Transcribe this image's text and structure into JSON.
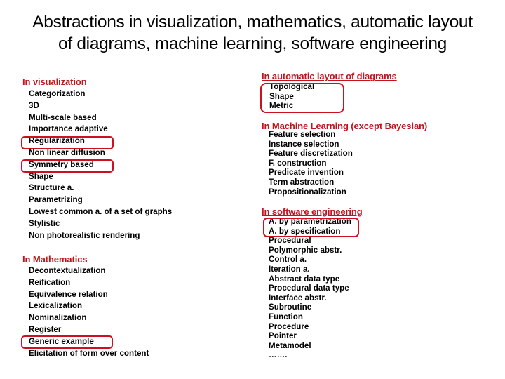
{
  "title": {
    "line1": "Abstractions in visualization, mathematics, automatic layout",
    "line2": "of diagrams, machine learning, software engineering"
  },
  "accent_color": "#c0141e",
  "sections": {
    "visualization": {
      "heading": "In visualization",
      "items": [
        "Categorization",
        "3D",
        "Multi-scale based",
        "Importance adaptive",
        "Regularization",
        "Non linear diffusion",
        "Symmetry based",
        "Shape",
        "Structure a.",
        "Parametrizing",
        "Lowest common a. of a set of graphs",
        "Stylistic",
        "Non photorealistic rendering"
      ],
      "highlighted": [
        "Regularization",
        "Symmetry based"
      ]
    },
    "mathematics": {
      "heading": "In Mathematics",
      "items": [
        "Decontextualization",
        "Reification",
        "Equivalence relation",
        "Lexicalization",
        "Nominalization",
        "Register",
        "Generic example",
        "Elicitation of form over content"
      ],
      "highlighted": [
        "Generic example"
      ]
    },
    "layout": {
      "heading": "In automatic layout of diagrams",
      "items": [
        "Topological",
        "Shape",
        "Metric"
      ],
      "highlighted": [
        "Topological",
        "Shape",
        "Metric"
      ]
    },
    "ml": {
      "heading": "In Machine Learning (except Bayesian)",
      "items": [
        "Feature selection",
        "Instance selection",
        "Feature discretization",
        "F. construction",
        "Predicate invention",
        "Term abstraction",
        "Propositionalization"
      ]
    },
    "se": {
      "heading": "In software engineering",
      "items": [
        "A. by parametrization",
        "A. by specification",
        "Procedural",
        "Polymorphic abstr.",
        "Control a.",
        "Iteration a.",
        "Abstract data type",
        "Procedural data type",
        "Interface abstr.",
        "Subroutine",
        "Function",
        "Procedure",
        "Pointer",
        "Metamodel",
        "……."
      ],
      "highlighted": [
        "A. by parametrization",
        "A. by specification"
      ]
    }
  }
}
